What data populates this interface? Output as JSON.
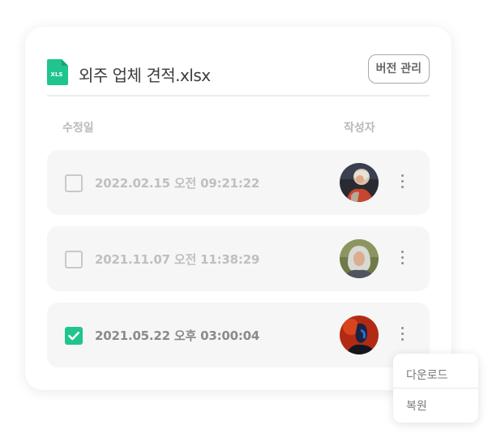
{
  "file": {
    "icon": "xlsx-file-icon",
    "icon_label": "XLS",
    "title": "외주 업체 견적.xlsx"
  },
  "header": {
    "version_button": "버전 관리"
  },
  "columns": {
    "date": "수정일",
    "author": "작성자"
  },
  "rows": [
    {
      "date": "2022.02.15 오전 09:21:22",
      "checked": false,
      "avatar": "avatar-elderly-woman-red-shirt"
    },
    {
      "date": "2021.11.07 오전 11:38:29",
      "checked": false,
      "avatar": "avatar-elderly-woman-gray-hair"
    },
    {
      "date": "2021.05.22 오후 03:00:04",
      "checked": true,
      "avatar": "avatar-person-red-background"
    }
  ],
  "menu": {
    "items": [
      "다운로드",
      "복원"
    ]
  },
  "colors": {
    "accent": "#1fc48e",
    "row_background": "#f6f6f6"
  }
}
